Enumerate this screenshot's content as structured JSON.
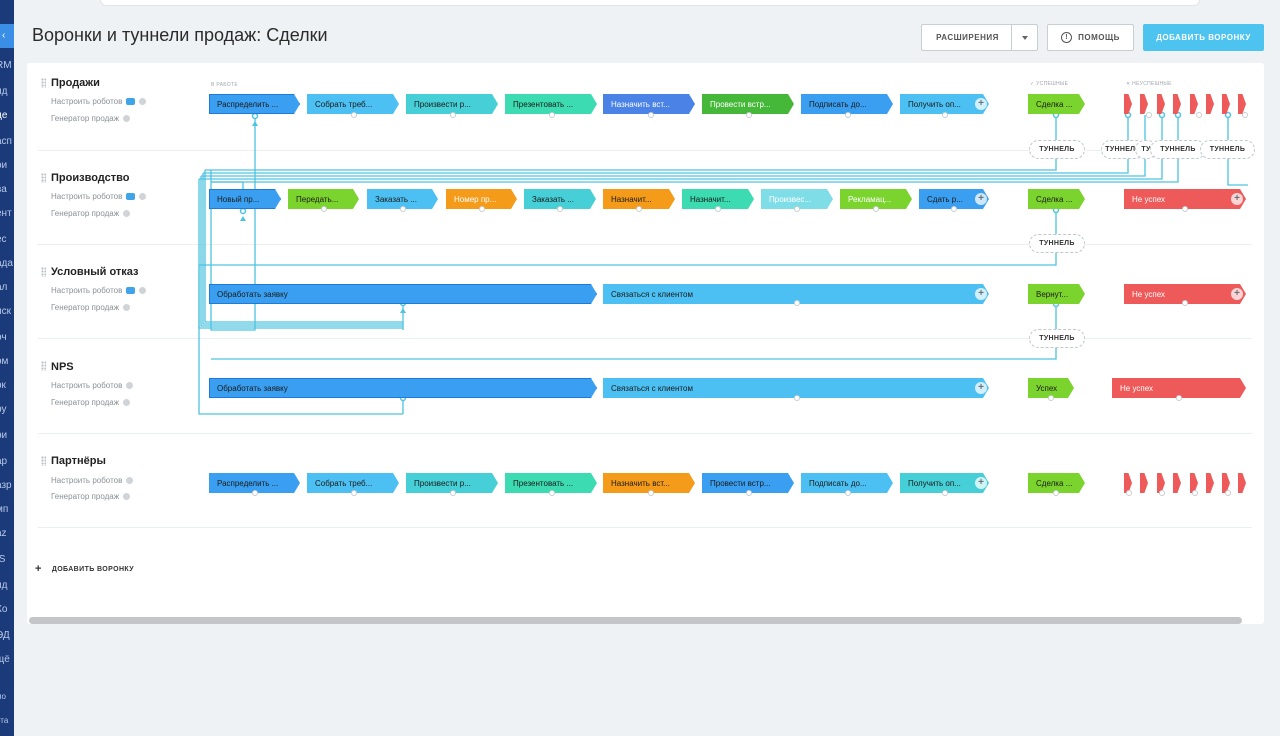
{
  "page": {
    "title": "Воронки и туннели продаж: Сделки"
  },
  "toolbar": {
    "extensions_label": "РАСШИРЕНИЯ",
    "help_label": "ПОМОЩЬ",
    "add_funnel_label": "ДОБАВИТЬ ВОРОНКУ"
  },
  "sidebar": {
    "items": [
      "RM",
      "ид",
      "де",
      "асп",
      "ои",
      "ва",
      "ент",
      "ес",
      "ада",
      "ал",
      "иск",
      "оч",
      "ом",
      "ок",
      "ру",
      "ри",
      "ар",
      "азр",
      "мп",
      "az",
      "IS",
      "ид",
      "Ко",
      "ЭД",
      "щё",
      "мо",
      "рта"
    ]
  },
  "headers": {
    "in_work": "В РАБОТЕ",
    "success": "✓ УСПЕШНЫЕ",
    "fail": "✕ НЕУСПЕШНЫЕ"
  },
  "colors": {
    "blue": "#3a9ff0",
    "lightblue": "#4cc0f2",
    "teal": "#46cfd6",
    "mint": "#3ddbb2",
    "navy": "#4a82e6",
    "green": "#45b83a",
    "lime": "#7bd32d",
    "orange": "#f59b1a",
    "red": "#ee5a5a",
    "tunnel_line": "#4ec3e0"
  },
  "robots_label": "Настроить роботов",
  "generator_label": "Генератор продаж",
  "tunnel_label": "ТУННЕЛЬ",
  "pipelines": [
    {
      "name": "Продажи",
      "stages": [
        "Распределить ...",
        "Собрать треб...",
        "Произвести р...",
        "Презентовать ...",
        "Назначить вст...",
        "Провести встр...",
        "Подписать до...",
        "Получить оп..."
      ],
      "success": "Сделка ...",
      "fail": ""
    },
    {
      "name": "Производство",
      "stages": [
        "Новый пр...",
        "Передать...",
        "Заказать ...",
        "Номер пр...",
        "Заказать ...",
        "Назначит...",
        "Назначит...",
        "Произвес...",
        "Рекламац...",
        "Сдать р..."
      ],
      "success": "Сделка ...",
      "fail": "Не успех"
    },
    {
      "name": "Условный отказ",
      "stages": [
        "Обработать заявку",
        "Связаться с клиентом"
      ],
      "success": "Вернут...",
      "fail": "Не успех"
    },
    {
      "name": "NPS",
      "stages": [
        "Обработать заявку",
        "Связаться с клиентом"
      ],
      "success": "Успех",
      "fail": "Не успех"
    },
    {
      "name": "Партнёры",
      "stages": [
        "Распределить ...",
        "Собрать треб...",
        "Произвести р...",
        "Презентовать ...",
        "Назначить вст...",
        "Провести встр...",
        "Подписать до...",
        "Получить оп..."
      ],
      "success": "Сделка ...",
      "fail": ""
    }
  ],
  "tunnels_row1": [
    "ТУННЕЛЬ",
    "ТУННЕЛЬ",
    "ТУ",
    "ТУННЕЛЬ",
    "ТУННЕЛЬ"
  ]
}
